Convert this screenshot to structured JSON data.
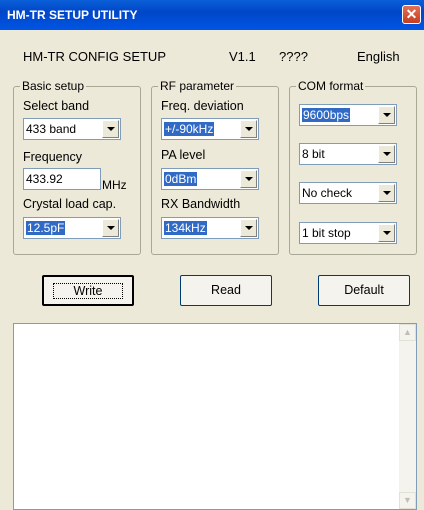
{
  "window": {
    "title": "HM-TR SETUP UTILITY",
    "close_glyph": "✕"
  },
  "header": {
    "title": "HM-TR CONFIG SETUP",
    "version": "V1.1",
    "unknown": "????",
    "language": "English"
  },
  "basic_setup": {
    "legend": "Basic setup",
    "band_label": "Select band",
    "band_value": "433 band",
    "frequency_label": "Frequency",
    "frequency_value": "433.92",
    "frequency_unit": "MHz",
    "crystal_label": "Crystal load cap.",
    "crystal_value": "12.5pF"
  },
  "rf_parameter": {
    "legend": "RF parameter",
    "deviation_label": "Freq. deviation",
    "deviation_value": "+/-90kHz",
    "pa_label": "PA level",
    "pa_value": "0dBm",
    "rx_label": "RX Bandwidth",
    "rx_value": "134kHz"
  },
  "com_format": {
    "legend": "COM format",
    "baud_value": "9600bps",
    "databits_value": "8 bit",
    "parity_value": "No check",
    "stopbits_value": "1 bit stop"
  },
  "buttons": {
    "write": "Write",
    "read": "Read",
    "default": "Default"
  },
  "log": {
    "text": ""
  }
}
